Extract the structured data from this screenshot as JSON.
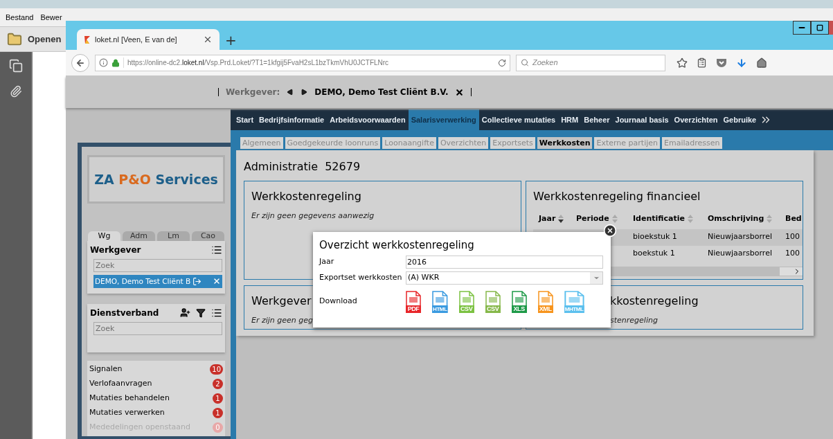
{
  "reader": {
    "menu": [
      "Bestand",
      "Bewer"
    ],
    "toolbar_button": "Openen"
  },
  "browser": {
    "tab_title": "loket.nl [Veen, E van de]",
    "new_tab": "+",
    "url_prefix": "https://online-dc2.",
    "url_domain": "loket.nl",
    "url_path": "/Vsp.Prd.Loket/?T1=1kfgij5FvaH2sL1bzTkmVhU0JCTFLNrc",
    "search_placeholder": "Zoeken"
  },
  "employer_bar": {
    "label": "Werkgever:",
    "value": "DEMO, Demo Test Cliënt B.V."
  },
  "logo": {
    "part1": "ZA",
    "part2": "P&O",
    "part3": "Services"
  },
  "sidebar": {
    "tabs": [
      {
        "label": "Wg",
        "selected": true
      },
      {
        "label": "Adm",
        "selected": false
      },
      {
        "label": "Lm",
        "selected": false
      },
      {
        "label": "Cao",
        "selected": false
      }
    ],
    "werkgever": {
      "title": "Werkgever",
      "search_placeholder": "Zoek",
      "selected_item": "DEMO, Demo Test Cliënt B"
    },
    "dienstverband": {
      "title": "Dienstverband",
      "search_placeholder": "Zoek"
    },
    "signals": [
      {
        "label": "Signalen",
        "count": "10",
        "disabled": false
      },
      {
        "label": "Verlofaanvragen",
        "count": "2",
        "disabled": false
      },
      {
        "label": "Mutaties behandelen",
        "count": "1",
        "disabled": false
      },
      {
        "label": "Mutaties verwerken",
        "count": "1",
        "disabled": false
      },
      {
        "label": "Mededelingen openstaand",
        "count": "0",
        "disabled": true
      }
    ]
  },
  "main_nav": [
    {
      "label": "Start",
      "selected": false
    },
    {
      "label": "Bedrijfsinformatie",
      "selected": false
    },
    {
      "label": "Arbeidsvoorwaarden",
      "selected": false
    },
    {
      "label": "Salarisverwerking",
      "selected": true
    },
    {
      "label": "Collectieve mutaties",
      "selected": false
    },
    {
      "label": "HRM",
      "selected": false
    },
    {
      "label": "Beheer",
      "selected": false
    },
    {
      "label": "Journaal basis",
      "selected": false
    },
    {
      "label": "Overzichten",
      "selected": false
    },
    {
      "label": "Gebruike",
      "selected": false
    }
  ],
  "sub_tabs": [
    {
      "label": "Algemeen",
      "selected": false
    },
    {
      "label": "Goedgekeurde loonruns",
      "selected": false
    },
    {
      "label": "Loonaangifte",
      "selected": false
    },
    {
      "label": "Overzichten",
      "selected": false
    },
    {
      "label": "Exportsets",
      "selected": false
    },
    {
      "label": "Werkkosten",
      "selected": true
    },
    {
      "label": "Externe partijen",
      "selected": false
    },
    {
      "label": "Emailadressen",
      "selected": false
    }
  ],
  "administration": {
    "label": "Administratie",
    "number": "52679"
  },
  "cards": [
    {
      "title": "Werkkostenregeling",
      "empty_text": "Er zijn geen gegevens aanwezig"
    },
    {
      "title": "Werkkostenregeling financieel",
      "table": {
        "columns": [
          {
            "label": "Jaar",
            "sorted": true
          },
          {
            "label": "Periode",
            "sorted": false
          },
          {
            "label": "Identificatie",
            "sorted": false
          },
          {
            "label": "Omschrijving",
            "sorted": false
          },
          {
            "label": "Bed"
          }
        ],
        "rows": [
          {
            "identificatie": "bioekstuk 1",
            "omschrijving": "Nieuwjaarsborrel",
            "column_5": "100"
          },
          {
            "identificatie": "boekstuk 1",
            "omschrijving": "Nieuwjaarsborrel",
            "column_5": "100"
          }
        ]
      }
    },
    {
      "title": "Werkgever",
      "empty_text": "Er zijn geen geg"
    },
    {
      "title": "kkostenregeling",
      "empty_text": "stenregeling"
    }
  ],
  "modal": {
    "title": "Overzicht werkkostenregeling",
    "year_label": "Jaar",
    "year_value": "2016",
    "exportset_label": "Exportset werkkosten",
    "exportset_value": "(A) WKR",
    "download_label": "Download",
    "downloads": [
      {
        "label": "PDF",
        "color": "#e8262a"
      },
      {
        "label": "HTML",
        "color": "#3a9ae0"
      },
      {
        "label": "CSV",
        "color": "#7cc242"
      },
      {
        "label": "CSV",
        "color": "#86b84a"
      },
      {
        "label": "XLS",
        "color": "#1e9a48"
      },
      {
        "label": "XML",
        "color": "#f7941d"
      },
      {
        "label": "MHTML",
        "color": "#5cc0ee"
      }
    ]
  }
}
